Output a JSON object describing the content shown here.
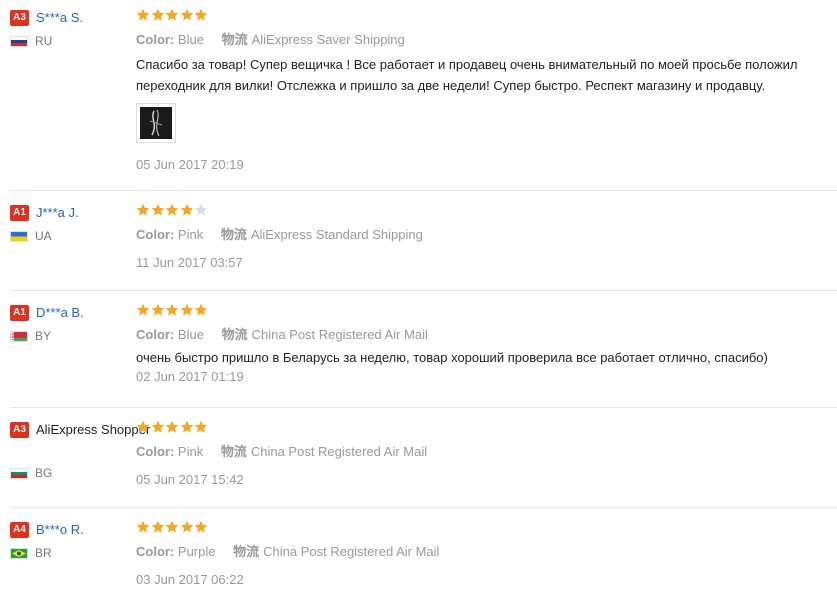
{
  "labels": {
    "color_label": "Color:",
    "ship_icon_char": "物流"
  },
  "colors": {
    "badge": "#e0301e",
    "name_link": "#1f66c2",
    "star_on": "#f5a623",
    "star_off": "#dddddd"
  },
  "reviews": [
    {
      "badge": "A3",
      "name": "S***a S.",
      "country": "RU",
      "flag": "ru",
      "stars": 5,
      "color": "Blue",
      "shipping": "AliExpress Saver Shipping",
      "text": "Спасибо за товар! Супер вещичка ! Все работает и продавец очень внимательный по моей просьбе положил переходник для вилки! Отслежка и пришло за две недели! Супер быстро. Респект магазину и продавцу.",
      "has_photo": true,
      "date": "05 Jun 2017 20:19"
    },
    {
      "badge": "A1",
      "name": "J***a J.",
      "country": "UA",
      "flag": "ua",
      "stars": 4,
      "color": "Pink",
      "shipping": "AliExpress Standard Shipping",
      "text": "",
      "has_photo": false,
      "date": "11 Jun 2017 03:57"
    },
    {
      "badge": "A1",
      "name": "D***a B.",
      "country": "BY",
      "flag": "by",
      "stars": 5,
      "color": "Blue",
      "shipping": "China Post Registered Air Mail",
      "text": "очень быстро пришло в Беларусь за неделю, товар хороший проверила все работает отлично, спасибо)",
      "has_photo": false,
      "date": "02 Jun 2017 01:19"
    },
    {
      "badge": "A3",
      "name": "AliExpress Shopper",
      "country": "BG",
      "flag": "bg",
      "stars": 5,
      "color": "Pink",
      "shipping": "China Post Registered Air Mail",
      "text": "",
      "has_photo": false,
      "date": "05 Jun 2017 15:42"
    },
    {
      "badge": "A4",
      "name": "B***o R.",
      "country": "BR",
      "flag": "br",
      "stars": 5,
      "color": "Purple",
      "shipping": "China Post Registered Air Mail",
      "text": "",
      "has_photo": false,
      "date": "03 Jun 2017 06:22"
    }
  ]
}
